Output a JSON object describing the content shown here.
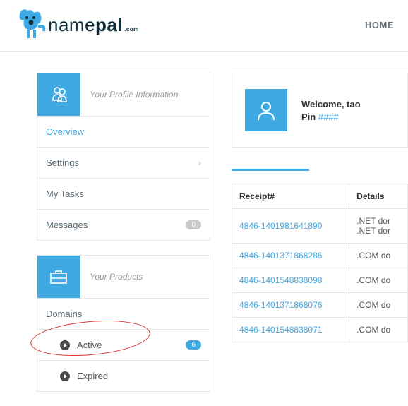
{
  "header": {
    "brand_name": "name",
    "brand_bold": "pal",
    "brand_tld": ".com",
    "nav_home": "HOME"
  },
  "profile_panel": {
    "title": "Your Profile Information",
    "items": {
      "overview": "Overview",
      "settings": "Settings",
      "tasks": "My Tasks",
      "messages": "Messages",
      "messages_count": "0"
    }
  },
  "products_panel": {
    "title": "Your Products",
    "domains_label": "Domains",
    "active_label": "Active",
    "active_count": "6",
    "expired_label": "Expired"
  },
  "welcome": {
    "line1": "Welcome, tao",
    "pin_label": "Pin ",
    "pin_value": "####"
  },
  "table": {
    "col_receipt": "Receipt#",
    "col_details": "Details",
    "rows": [
      {
        "receipt": "4846-1401981641890",
        "detail1": ".NET dor",
        "detail2": ".NET dor"
      },
      {
        "receipt": "4846-1401371868286",
        "detail1": ".COM do"
      },
      {
        "receipt": "4846-1401548838098",
        "detail1": ".COM do"
      },
      {
        "receipt": "4846-1401371868076",
        "detail1": ".COM do"
      },
      {
        "receipt": "4846-1401548838071",
        "detail1": ".COM do"
      }
    ]
  }
}
